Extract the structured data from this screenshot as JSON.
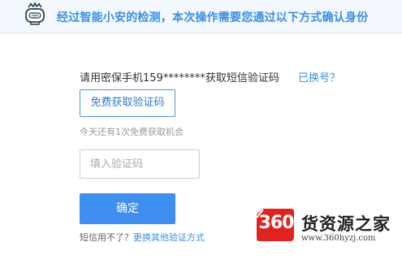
{
  "header": {
    "title": "经过智能小安的检测，本次操作需要您通过以下方式确认身份",
    "accent_color": "#3a8fe6",
    "icon": "robot-icon"
  },
  "verify": {
    "prompt": "请用密保手机159********获取短信验证码",
    "change_link": "已换号？",
    "get_code_label": "免费获取验证码",
    "remaining_text": "今天还有1次免费获取机会",
    "code_placeholder": "填入验证码",
    "code_value": "",
    "confirm_label": "确定",
    "help_question": "短信用不了？",
    "help_link": "更换其他验证方式"
  },
  "watermark": {
    "number": "360",
    "name": "货资源之家",
    "url": "www.360hyzj.com",
    "brand_color": "#e0231e"
  }
}
